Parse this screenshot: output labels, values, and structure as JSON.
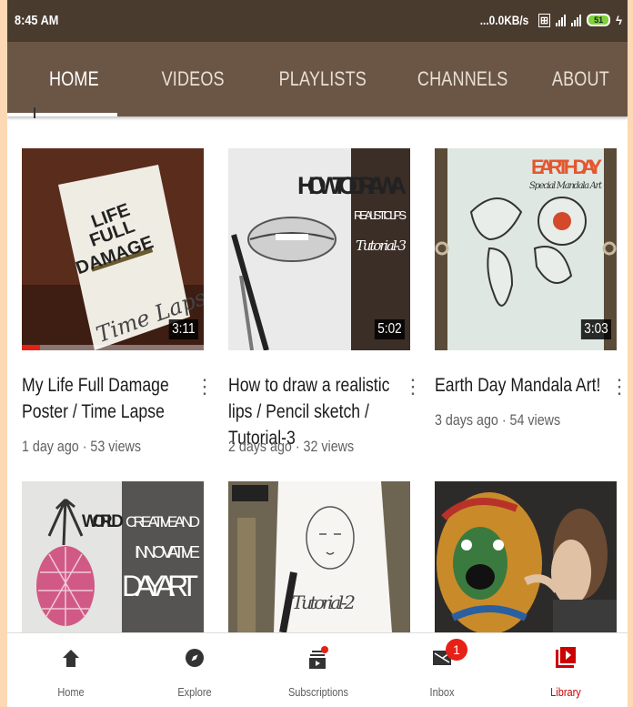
{
  "status_bar": {
    "time": "8:45 AM",
    "net_speed": "...0.0KB/s",
    "battery": "51"
  },
  "tabs": [
    {
      "label": "HOME",
      "active": true
    },
    {
      "label": "VIDEOS",
      "active": false
    },
    {
      "label": "PLAYLISTS",
      "active": false
    },
    {
      "label": "CHANNELS",
      "active": false
    },
    {
      "label": "ABOUT",
      "active": false
    }
  ],
  "videos": [
    {
      "title": "My Life Full Damage Poster / Time Lapse",
      "meta": "1 day ago · 53 views",
      "duration": "3:11",
      "watched_fraction": 0.1,
      "thumb_text": [
        "LIFE",
        "FULL",
        "DAMAGE",
        "Time Lapse"
      ]
    },
    {
      "title": "How to draw a realistic lips / Pencil sketch / Tutorial-3",
      "meta": "2 days ago · 32 views",
      "duration": "5:02",
      "thumb_text": [
        "HOW TO DRAW A",
        "REALISTIC LIPS",
        "Tutorial-3"
      ]
    },
    {
      "title": "Earth Day Mandala Art!",
      "meta": "3 days ago · 54 views",
      "duration": "3:03",
      "thumb_text": [
        "EARTH DAY",
        "Special Mandala Art"
      ]
    },
    {
      "thumb_text": [
        "WORLD",
        "CREATIVE AND",
        "INNOVATIVE",
        "DAY ART"
      ]
    },
    {
      "thumb_text": [
        "Tutorial-2"
      ]
    },
    {
      "thumb_text": []
    }
  ],
  "bottom_nav": [
    {
      "label": "Home",
      "icon": "home-icon"
    },
    {
      "label": "Explore",
      "icon": "compass-icon"
    },
    {
      "label": "Subscriptions",
      "icon": "subscriptions-icon"
    },
    {
      "label": "Inbox",
      "icon": "inbox-icon",
      "badge": "1"
    },
    {
      "label": "Library",
      "icon": "library-icon",
      "active": true
    }
  ],
  "colors": {
    "header_brown": "#6b5646",
    "status_brown": "#4a3b2f",
    "accent_red": "#e62117",
    "page_border": "#fcd9b4"
  }
}
